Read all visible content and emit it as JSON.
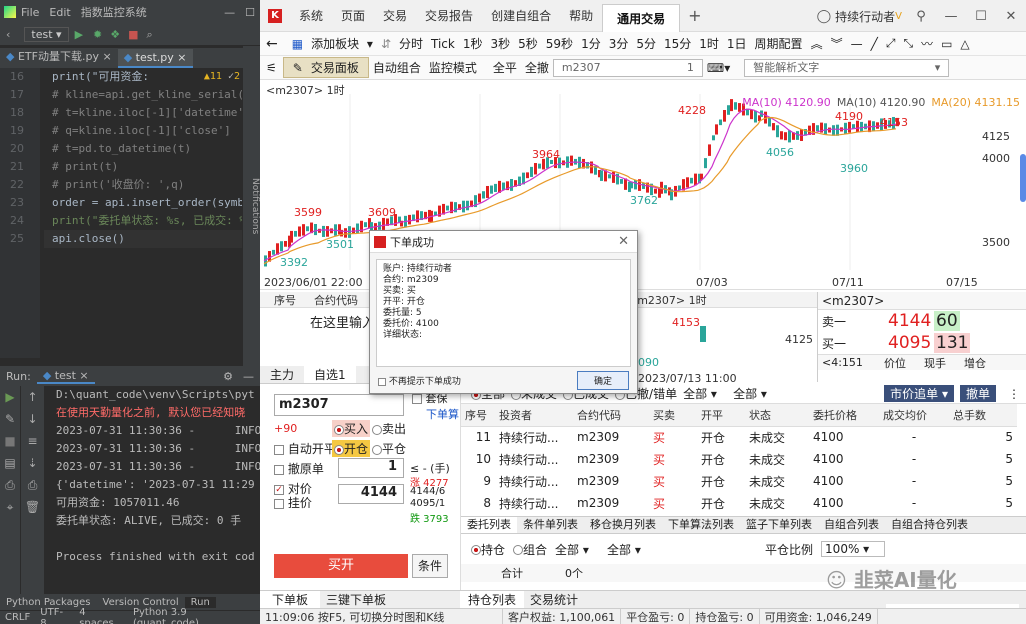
{
  "ide": {
    "menu": [
      "File",
      "Edit",
      "指数监控系统"
    ],
    "run_config": "test",
    "tabs": [
      "ETF动量下载.py",
      "test.py"
    ],
    "inspection": {
      "warnings": "11",
      "weak": "2"
    },
    "line_numbers": [
      "16",
      "17",
      "18",
      "19",
      "20",
      "21",
      "22",
      "23",
      "24",
      "25"
    ],
    "code": [
      "print(\"可用资金:",
      "# kline=api.get_kline_serial('",
      "# t=kline.iloc[-1]['datetime'",
      "# q=kline.iloc[-1]['close']",
      "# t=pd.to_datetime(t)",
      "# print(t)",
      "# print('收盘价: ',q)",
      "order = api.insert_order(symbol",
      "print(\"委托单状态: %s, 已成交: %d",
      "api.close()"
    ],
    "notifications_label": "Notifications",
    "run_label": "Run:",
    "run_tab": "test",
    "console": [
      "D:\\quant_code\\venv\\Scripts\\pyt",
      "在使用天勤量化之前, 默认您已经知晓",
      "2023-07-31 11:30:36 -      INFO",
      "2023-07-31 11:30:36 -      INFO",
      "2023-07-31 11:30:36 -      INFO",
      "{'datetime': '2023-07-31 11:29",
      "可用资金: 1057011.46",
      "委托单状态: ALIVE, 已成交: 0 手",
      "",
      "Process finished with exit cod"
    ],
    "bottom_tabs": [
      "Python Packages",
      "Version Control",
      "Run"
    ],
    "status": [
      "CRLF",
      "UTF-8",
      "4 spaces",
      "Python 3.9 (quant_code)"
    ]
  },
  "app": {
    "menu": [
      "系统",
      "页面",
      "交易",
      "交易报告",
      "创建自组合",
      "帮助"
    ],
    "active_tab": "通用交易",
    "user": "持续行动者",
    "user_badge": "V",
    "toolbar1": {
      "add_block": "添加板块",
      "periods": [
        "分时",
        "Tick",
        "1秒",
        "3秒",
        "5秒",
        "59秒",
        "1分",
        "3分",
        "5分",
        "15分",
        "1时",
        "1日",
        "周期配置"
      ]
    },
    "toolbar2": {
      "trade_panel": "交易面板",
      "auto_combo": "自动组合",
      "monitor_mode": "监控模式",
      "close_all": "全平",
      "cancel_all": "全撤",
      "symbol": "m2307",
      "qty": "1",
      "smart_text": "智能解析文字"
    },
    "chart": {
      "title": "<m2307> 1时",
      "ma10_label": "MA(10) 4120.90",
      "ma20_label": "MA(20) 4131.15",
      "price_labels": [
        "3599",
        "3609",
        "3964",
        "4228",
        "4190",
        "4153",
        "3501",
        "3392",
        "3762",
        "4056",
        "3960"
      ],
      "axis_prices": [
        "4125",
        "4000",
        "3500"
      ],
      "dates": [
        "2023/06/01 22:00",
        "07/03",
        "07/11",
        "07/15"
      ],
      "last_price_tag": "4125"
    },
    "grid": {
      "headers": [
        "序号",
        "合约代码"
      ],
      "input_hint": "在这里输入",
      "sub_title": "<m2307> 1时",
      "label_4153": "4153",
      "label_4090": "090",
      "time": "2023/07/13 11:00",
      "axis_4125": "4125"
    },
    "book": {
      "title": "<m2307>",
      "ask_label": "卖一",
      "ask_price": "4144",
      "ask_vol": "60",
      "bid_label": "买一",
      "bid_price": "4095",
      "bid_vol": "131",
      "row_label": "<4:151",
      "cols": [
        "价位",
        "现手",
        "增仓"
      ]
    },
    "order_tabs": [
      "主力",
      "自选1"
    ],
    "order_form": {
      "symbol": "m2307",
      "side_buy": "买入",
      "side_sell": "卖出",
      "offset_open": "开仓",
      "offset_close": "平仓",
      "plus90": "+90",
      "auto_close": "自动开平",
      "cancel_order": "撤原单",
      "qty": "1",
      "qty_unit": "≤ - (手)",
      "up_limit": "涨 4277",
      "counter_price": "对价",
      "limit": "挂价",
      "price": "4144",
      "p1": "4144/6",
      "p2": "4095/1",
      "down_limit": "跌 3793",
      "buy_open": "买开",
      "condition": "条件",
      "hedge": "套保",
      "order_calc": "下单算",
      "bottom_tabs": [
        "下单板",
        "三键下单板"
      ]
    },
    "dialog": {
      "title": "下单成功",
      "lines": [
        "账户: 持续行动者",
        "合约: m2309",
        "买卖: 买",
        "开平: 开仓",
        "委托量: 5",
        "委托价: 4100",
        "详细状态:"
      ],
      "dont_show": "不再提示下单成功",
      "ok": "确定"
    },
    "orders": {
      "filters": [
        "全部",
        "未成交",
        "已成交",
        "已撤/错单"
      ],
      "select1": "全部",
      "select2": "全部",
      "market_chase": "市价追单",
      "cancel": "撤单",
      "columns": [
        "序号",
        "投资者",
        "合约代码",
        "买卖",
        "开平",
        "状态",
        "委托价格",
        "成交均价",
        "总手数"
      ],
      "rows": [
        [
          "11",
          "持续行动...",
          "m2309",
          "买",
          "开仓",
          "未成交",
          "4100",
          "-",
          "5"
        ],
        [
          "10",
          "持续行动...",
          "m2309",
          "买",
          "开仓",
          "未成交",
          "4100",
          "-",
          "5"
        ],
        [
          "9",
          "持续行动...",
          "m2309",
          "买",
          "开仓",
          "未成交",
          "4100",
          "-",
          "5"
        ],
        [
          "8",
          "持续行动...",
          "m2309",
          "买",
          "开仓",
          "未成交",
          "4100",
          "-",
          "5"
        ]
      ],
      "sub_tabs": [
        "委托列表",
        "条件单列表",
        "移仓换月列表",
        "下单算法列表",
        "篮子下单列表",
        "自组合列表",
        "自组合持仓列表"
      ]
    },
    "positions": {
      "filters": [
        "持仓",
        "组合"
      ],
      "select1": "全部",
      "select2": "全部",
      "close_ratio_label": "平仓比例",
      "close_ratio": "100%",
      "total_label": "合计",
      "total_lots": "0个",
      "tabs": [
        "持仓列表",
        "交易统计"
      ]
    },
    "watermark": "韭菜AI量化",
    "statusbar": {
      "hint": "11:09:06 按F5, 可切换分时图和K线",
      "equity": "客户权益: 1,100,061",
      "close_pnl": "平仓盈亏: 0",
      "float_pnl": "持仓盈亏: 0",
      "available": "可用资金: 1,046,249"
    },
    "colors": {
      "red": "#e02020",
      "green": "#119911",
      "ma10": "#cc33cc",
      "ma20": "#e89a2a"
    }
  }
}
